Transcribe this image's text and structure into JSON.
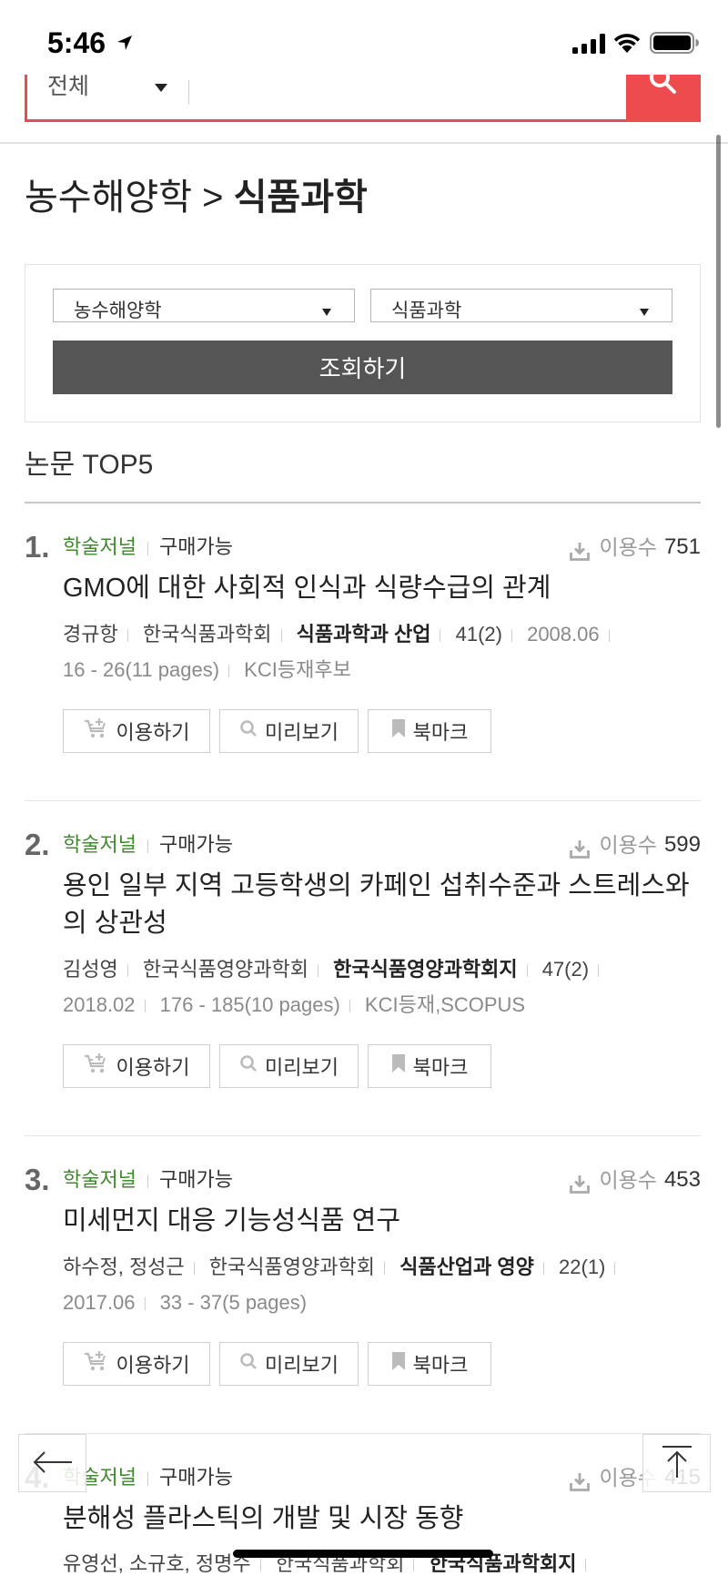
{
  "status_bar": {
    "time": "5:46"
  },
  "search": {
    "scope": "전체",
    "query": ""
  },
  "breadcrumb": {
    "parent": "농수해양학",
    "separator": ">",
    "current": "식품과학"
  },
  "filter": {
    "category": "농수해양학",
    "subcategory": "식품과학",
    "submit": "조회하기"
  },
  "section_title": "논문 TOP5",
  "labels": {
    "usage": "이용수"
  },
  "colors": {
    "accent": "#ee4b4f",
    "green": "#3f8a2e",
    "button-dark": "#555555"
  },
  "icons": {
    "status": [
      "location-arrow",
      "cellular-signal",
      "wifi",
      "battery"
    ],
    "usage": "download",
    "actions": [
      "cart-plus",
      "search",
      "bookmark"
    ],
    "floating": [
      "arrow-left",
      "arrow-up-to-top"
    ]
  },
  "papers": [
    {
      "rank": "1.",
      "type": "학술저널",
      "availability": "구매가능",
      "usage_count": "751",
      "title": "GMO에 대한 사회적 인식과 식량수급의 관계",
      "authors": "경규항",
      "publisher": "한국식품과학회",
      "journal": "식품과학과 산업",
      "issue": "41(2)",
      "date": "2008.06",
      "pages": "16 - 26(11 pages)",
      "indexing": "KCI등재후보",
      "actions": {
        "use": "이용하기",
        "preview": "미리보기",
        "bookmark": "북마크"
      }
    },
    {
      "rank": "2.",
      "type": "학술저널",
      "availability": "구매가능",
      "usage_count": "599",
      "title": "용인 일부 지역 고등학생의 카페인 섭취수준과 스트레스와의 상관성",
      "authors": "김성영",
      "publisher": "한국식품영양과학회",
      "journal": "한국식품영양과학회지",
      "issue": "47(2)",
      "date": "2018.02",
      "pages": "176 - 185(10 pages)",
      "indexing": "KCI등재,SCOPUS",
      "actions": {
        "use": "이용하기",
        "preview": "미리보기",
        "bookmark": "북마크"
      }
    },
    {
      "rank": "3.",
      "type": "학술저널",
      "availability": "구매가능",
      "usage_count": "453",
      "title": "미세먼지 대응 기능성식품 연구",
      "authors": "하수정, 정성근",
      "publisher": "한국식품영양과학회",
      "journal": "식품산업과 영양",
      "issue": "22(1)",
      "date": "2017.06",
      "pages": "33 - 37(5 pages)",
      "actions": {
        "use": "이용하기",
        "preview": "미리보기",
        "bookmark": "북마크"
      }
    },
    {
      "rank": "4.",
      "type": "학술저널",
      "availability": "구매가능",
      "usage_count": "415",
      "title": "분해성 플라스틱의 개발 및 시장 동향",
      "authors": "유영선, 소규호, 정명수",
      "publisher": "한국식품과학회",
      "journal": "한국식품과학회지"
    }
  ]
}
